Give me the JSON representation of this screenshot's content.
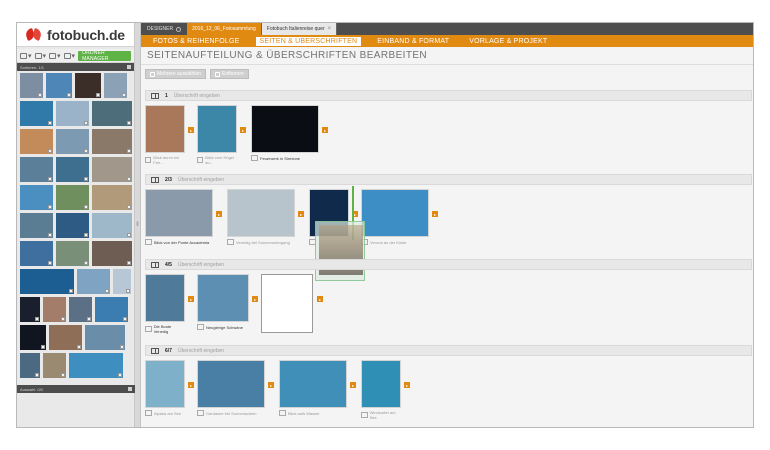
{
  "sidebar": {
    "logo": "fotobuch.de",
    "ordner_button": "ORDNER MANAGER",
    "bar_label": "Sortieren: 1/1",
    "bottom_label": "Auswahl: 0/0",
    "thumbs": [
      {
        "color": "#7d8ea3",
        "w": "w23"
      },
      {
        "color": "#4f86b8",
        "w": "w26"
      },
      {
        "color": "#3b2d28",
        "w": "w26"
      },
      {
        "color": "#8aa1b6",
        "w": "w23"
      },
      {
        "color": "#2f7aa8",
        "w": "w33"
      },
      {
        "color": "#9bb3c8",
        "w": "w33"
      },
      {
        "color": "#4d6d7a",
        "w": "w40"
      },
      {
        "color": "#c38a5a",
        "w": "w33"
      },
      {
        "color": "#7c9ab2",
        "w": "w33"
      },
      {
        "color": "#8a7868",
        "w": "w40"
      },
      {
        "color": "#5c7f99",
        "w": "w33"
      },
      {
        "color": "#3e6f8f",
        "w": "w33"
      },
      {
        "color": "#a1978a",
        "w": "w40"
      },
      {
        "color": "#4a8fbf",
        "w": "w33"
      },
      {
        "color": "#6f8f5f",
        "w": "w33"
      },
      {
        "color": "#b19a7a",
        "w": "w40"
      },
      {
        "color": "#5a7d93",
        "w": "w33"
      },
      {
        "color": "#2d5b84",
        "w": "w33"
      },
      {
        "color": "#9fb8c9",
        "w": "w40"
      },
      {
        "color": "#3f6f9f",
        "w": "w33"
      },
      {
        "color": "#7a8f77",
        "w": "w33"
      },
      {
        "color": "#6d5d52",
        "w": "w40"
      },
      {
        "color": "#1c5e92",
        "w": "w54"
      },
      {
        "color": "#7fa4c3",
        "w": "w33"
      },
      {
        "color": "#b7c7d6",
        "w": "w18"
      },
      {
        "color": "#1a1f2e",
        "w": "w20"
      },
      {
        "color": "#a37c6a",
        "w": "w23"
      },
      {
        "color": "#5b6f85",
        "w": "w23"
      },
      {
        "color": "#3c7db1",
        "w": "w33"
      },
      {
        "color": "#101520",
        "w": "w26"
      },
      {
        "color": "#8f6e58",
        "w": "w33"
      },
      {
        "color": "#6a8daa",
        "w": "w40"
      },
      {
        "color": "#4b6a82",
        "w": "w20"
      },
      {
        "color": "#9a8a72",
        "w": "w23"
      },
      {
        "color": "#3e8ec0",
        "w": "w54"
      }
    ]
  },
  "tabs": {
    "designer": "DESIGNER",
    "project": "2016_12_06_Fotosammlung",
    "book": "Fotobuch Italienreise quer"
  },
  "nav": {
    "items": [
      "FOTOS & REIHENFOLGE",
      "SEITEN & ÜBERSCHRIFTEN",
      "EINBAND & FORMAT",
      "VORLAGE & PROJEKT"
    ],
    "active_index": 1
  },
  "page_title": "SEITENAUFTEILUNG & ÜBERSCHRIFTEN BEARBEITEN",
  "actions": {
    "select_multiple": "Mehrere auswählen",
    "remove": "Entfernen"
  },
  "caption_placeholder": "Überschrift eingeben",
  "rows": [
    {
      "number": "1",
      "photos": [
        {
          "color": "#a9785a",
          "caption": "Blick durch ein Fen..."
        },
        {
          "color": "#3c86a8",
          "caption": "Blick vom Hügel au..."
        },
        {
          "color": "#0b0d14",
          "caption": "Feuerwerk in Sirmione",
          "dark": true
        }
      ]
    },
    {
      "number": "2/3",
      "photos": [
        {
          "color": "#8a9aaa",
          "caption": "Blick von der Ponte Accademia",
          "dark": true
        },
        {
          "color": "#b8c4cc",
          "caption": "Venedig bei Sonnenuntergang"
        },
        {
          "color": "#0f2a4a",
          "caption": ""
        },
        {
          "color": "#3d8ec4",
          "caption": "Verona an der Küste"
        }
      ]
    },
    {
      "number": "4/5",
      "photos": [
        {
          "color": "#4f7a9a",
          "caption": "Die Boote Venedig",
          "dark": true
        },
        {
          "color": "#5d8fb3",
          "caption": "Neugierige Schwäne",
          "dark": true
        }
      ]
    },
    {
      "number": "6/7",
      "photos": [
        {
          "color": "#7fb0c9",
          "caption": "Alpaka am See"
        },
        {
          "color": "#4a7fa5",
          "caption": "Gardasee bei Sonnenschein"
        },
        {
          "color": "#3f8fb9",
          "caption": "Blick aufs Wasser"
        },
        {
          "color": "#2f8fb5",
          "caption": "Windsurfer am See"
        }
      ]
    }
  ]
}
